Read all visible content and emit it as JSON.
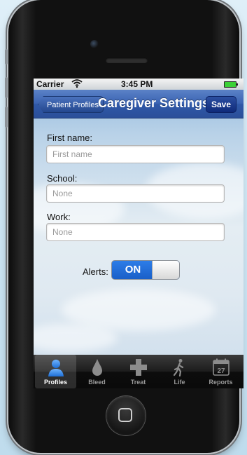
{
  "status": {
    "carrier": "Carrier",
    "time": "3:45 PM"
  },
  "nav": {
    "back_label": "Patient Profiles",
    "title": "Caregiver Settings",
    "save_label": "Save"
  },
  "form": {
    "first_name": {
      "label": "First name:",
      "value": "",
      "placeholder": "First name"
    },
    "school": {
      "label": "School:",
      "value": "",
      "placeholder": "None"
    },
    "work": {
      "label": "Work:",
      "value": "",
      "placeholder": "None"
    },
    "alerts": {
      "label": "Alerts:",
      "state": "ON"
    }
  },
  "tabs": [
    {
      "label": "Profiles",
      "icon": "person-icon",
      "active": true
    },
    {
      "label": "Bleed",
      "icon": "drop-icon",
      "active": false
    },
    {
      "label": "Treat",
      "icon": "cross-icon",
      "active": false
    },
    {
      "label": "Life",
      "icon": "walking-icon",
      "active": false
    },
    {
      "label": "Reports",
      "icon": "calendar-icon",
      "active": false,
      "badge": "27"
    }
  ],
  "colors": {
    "navbar": "#3b64b3",
    "toggle_on": "#2d7de8",
    "tabbar": "#1c1c1c"
  }
}
